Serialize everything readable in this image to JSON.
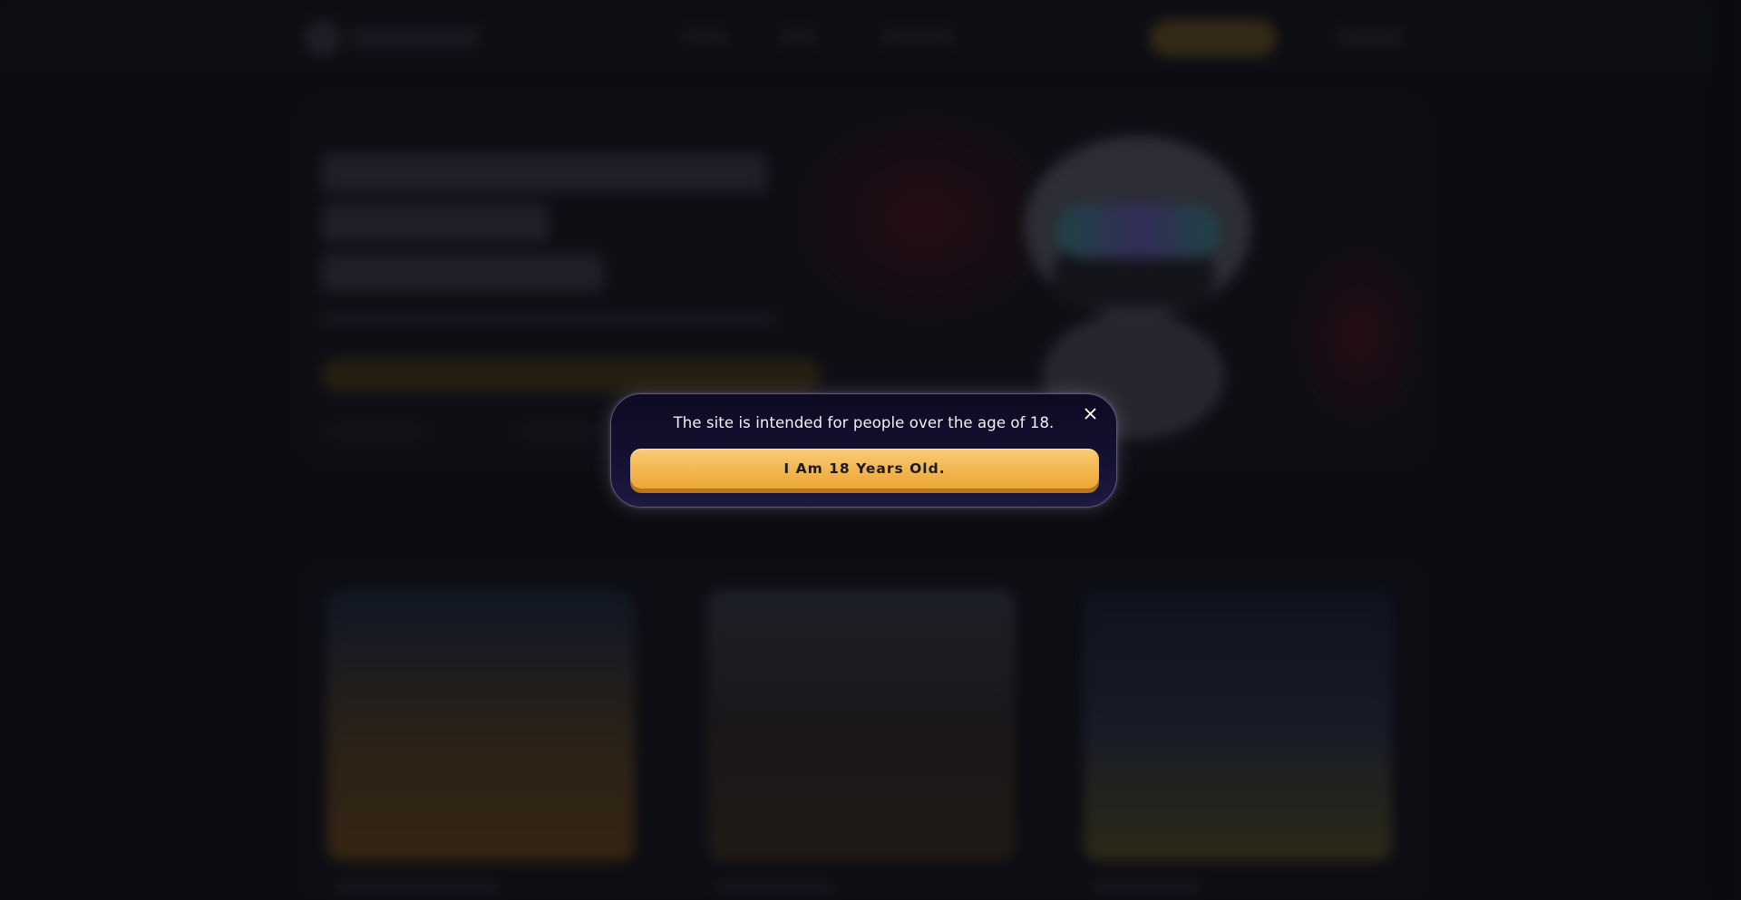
{
  "age_modal": {
    "message": "The site is intended for people over the age of 18.",
    "confirm_label": "I Am 18 Years Old.",
    "close_icon": "close-icon"
  },
  "colors": {
    "modal_background": "#131030",
    "modal_border": "#5b5680",
    "button_gold": "#f2b64f",
    "button_shadow": "#b87718",
    "page_background": "#111216"
  }
}
